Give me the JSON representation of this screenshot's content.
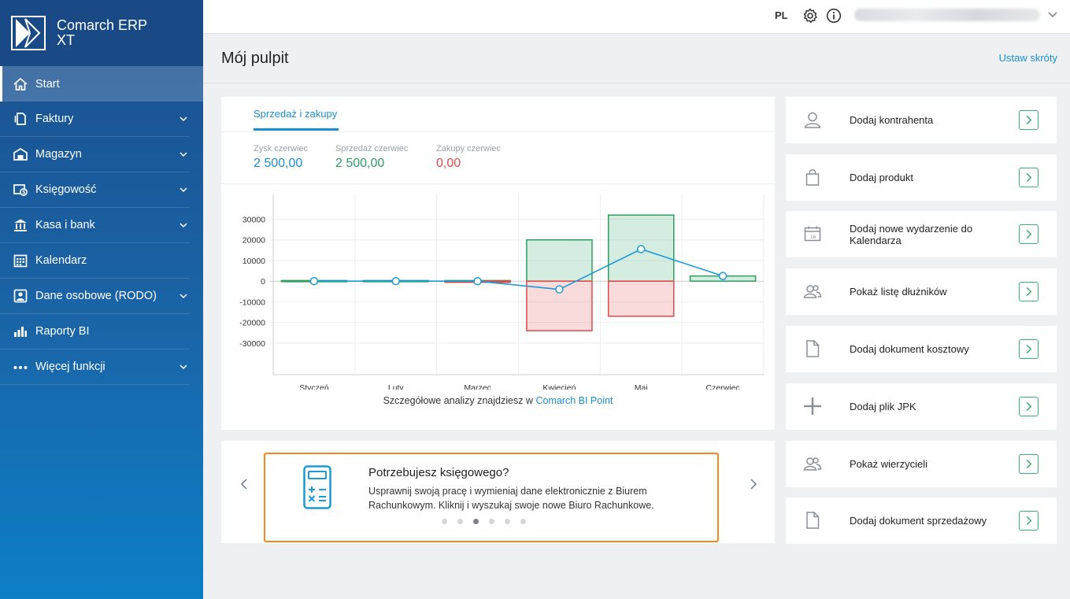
{
  "app": {
    "name_line1": "Comarch ERP",
    "name_line2": "XT"
  },
  "sidebar": {
    "items": [
      {
        "label": "Start",
        "icon": "home-icon",
        "active": true,
        "expandable": false
      },
      {
        "label": "Faktury",
        "icon": "invoices-icon",
        "active": false,
        "expandable": true
      },
      {
        "label": "Magazyn",
        "icon": "warehouse-icon",
        "active": false,
        "expandable": true
      },
      {
        "label": "Księgowość",
        "icon": "accounting-icon",
        "active": false,
        "expandable": true
      },
      {
        "label": "Kasa i bank",
        "icon": "bank-icon",
        "active": false,
        "expandable": true
      },
      {
        "label": "Kalendarz",
        "icon": "calendar-icon",
        "active": false,
        "expandable": false
      },
      {
        "label": "Dane osobowe (RODO)",
        "icon": "personal-data-icon",
        "active": false,
        "expandable": true
      },
      {
        "label": "Raporty BI",
        "icon": "bar-chart-icon",
        "active": false,
        "expandable": false
      },
      {
        "label": "Więcej funkcji",
        "icon": "more-dots-icon",
        "active": false,
        "expandable": true
      }
    ]
  },
  "topbar": {
    "lang": "PL"
  },
  "header": {
    "title": "Mój pulpit",
    "shortcuts_link": "Ustaw skróty"
  },
  "dashboard": {
    "tab": "Sprzedaż i zakupy",
    "stats": [
      {
        "label": "Zysk czerwiec",
        "value": "2 500,00",
        "color": "#1a8fd0"
      },
      {
        "label": "Sprzedaż czerwiec",
        "value": "2 500,00",
        "color": "#2e9e63"
      },
      {
        "label": "Zakupy czerwiec",
        "value": "0,00",
        "color": "#e04a4a"
      }
    ],
    "bi_note_prefix": "Szczegółowe analizy znajdziesz w ",
    "bi_note_link": "Comarch BI Point"
  },
  "chart_data": {
    "type": "bar",
    "categories": [
      "Styczeń",
      "Luty",
      "Marzec",
      "Kwiecień",
      "Maj",
      "Czerwiec"
    ],
    "series": [
      {
        "values": [
          300,
          300,
          300,
          20000,
          32000,
          2500
        ],
        "color": "#2e9e63"
      },
      {
        "values": [
          0,
          0,
          -300,
          -24000,
          -17000,
          0
        ],
        "color": "#e04a4a"
      },
      {
        "values": [
          0,
          0,
          0,
          -4000,
          15500,
          2500
        ],
        "color": "#1a9ad6",
        "kind": "line"
      }
    ],
    "yticks": [
      30000,
      20000,
      10000,
      0,
      -10000,
      -20000,
      -30000
    ],
    "ylim": [
      -43000,
      42000
    ],
    "grid": true
  },
  "promo": {
    "title": "Potrzebujesz księgowego?",
    "text": "Usprawnij swoją pracę i wymieniaj dane elektronicznie z Biurem Rachunkowym. Kliknij i wyszukaj swoje nowe Biuro Rachunkowe.",
    "dots": 6,
    "active_dot": 2
  },
  "quick_actions": [
    {
      "label": "Dodaj kontrahenta",
      "icon": "person-icon"
    },
    {
      "label": "Dodaj produkt",
      "icon": "shopping-bag-icon"
    },
    {
      "label": "Dodaj nowe wydarzenie do Kalendarza",
      "icon": "calendar-event-icon"
    },
    {
      "label": "Pokaż listę dłużników",
      "icon": "people-icon"
    },
    {
      "label": "Dodaj dokument kosztowy",
      "icon": "document-icon"
    },
    {
      "label": "Dodaj plik JPK",
      "icon": "plus-icon"
    },
    {
      "label": "Pokaż wierzycieli",
      "icon": "people-icon"
    },
    {
      "label": "Dodaj dokument sprzedażowy",
      "icon": "document-icon"
    }
  ]
}
